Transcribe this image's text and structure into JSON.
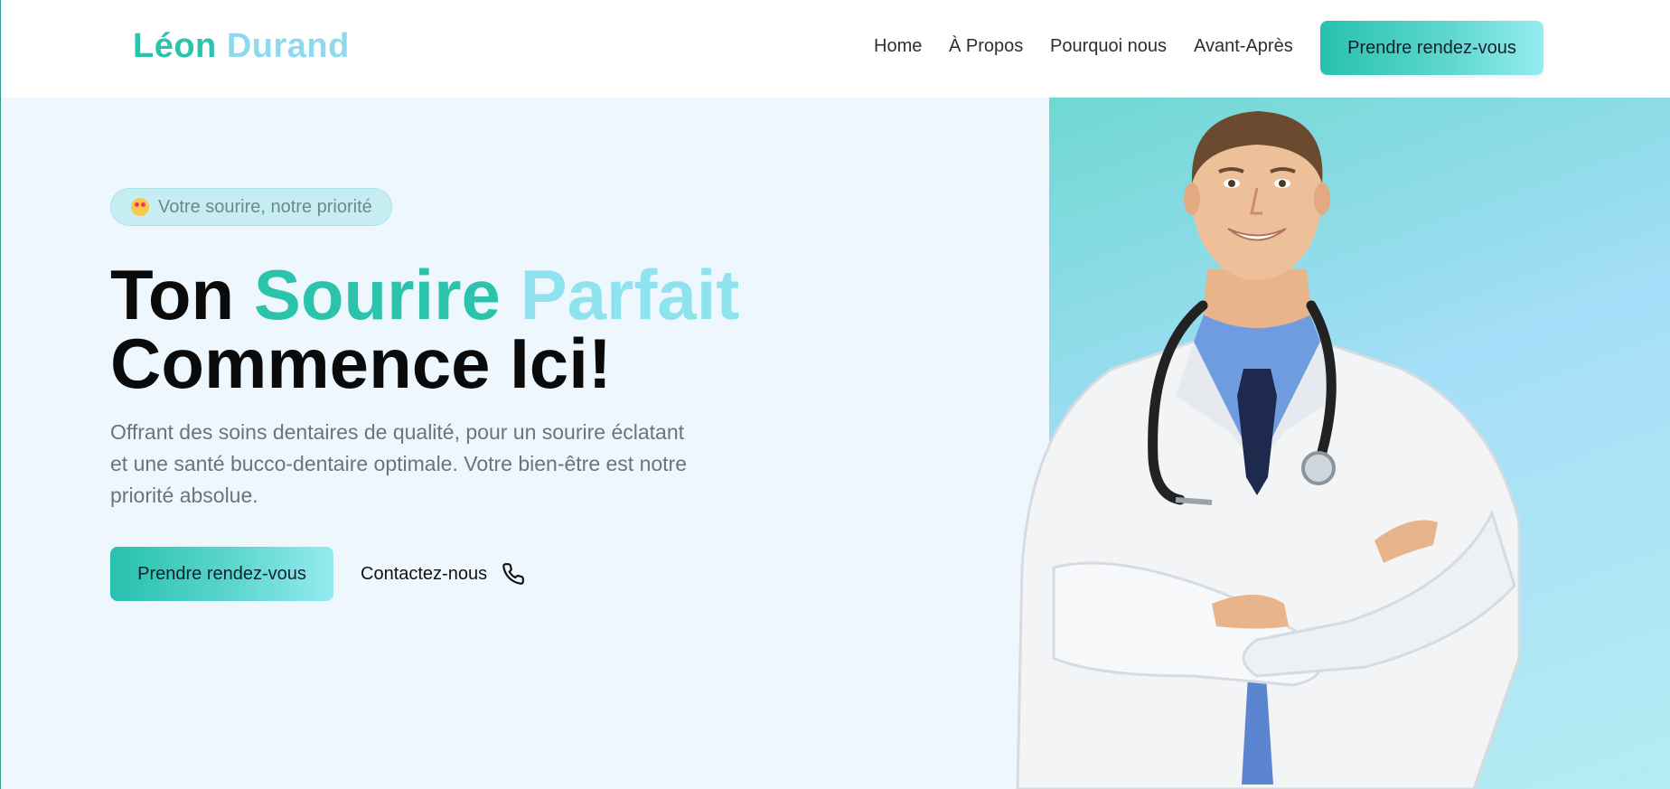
{
  "header": {
    "logo_first": "Léon",
    "logo_last": "Durand",
    "nav": {
      "home": "Home",
      "about": "À Propos",
      "why": "Pourquoi nous",
      "before_after": "Avant-Après"
    },
    "cta_label": "Prendre rendez-vous"
  },
  "hero": {
    "badge": "Votre sourire, notre priorité",
    "title_line1_a": "Ton ",
    "title_line1_b": "Sourire ",
    "title_line1_c": "Parfait",
    "title_line2": "Commence Ici!",
    "description": "Offrant des soins dentaires de qualité, pour un sourire éclatant et une santé bucco-dentaire optimale. Votre bien-être est notre priorité absolue.",
    "primary_cta": "Prendre rendez-vous",
    "secondary_cta": "Contactez-nous"
  },
  "icons": {
    "badge": "star-struck-emoji-icon",
    "contact": "phone-icon"
  },
  "colors": {
    "accent": "#2cc3ac",
    "accent_light": "#8fe3ef",
    "background": "#eef7fd",
    "text_dark": "#0a0a0a",
    "text_muted": "#6d7479"
  }
}
